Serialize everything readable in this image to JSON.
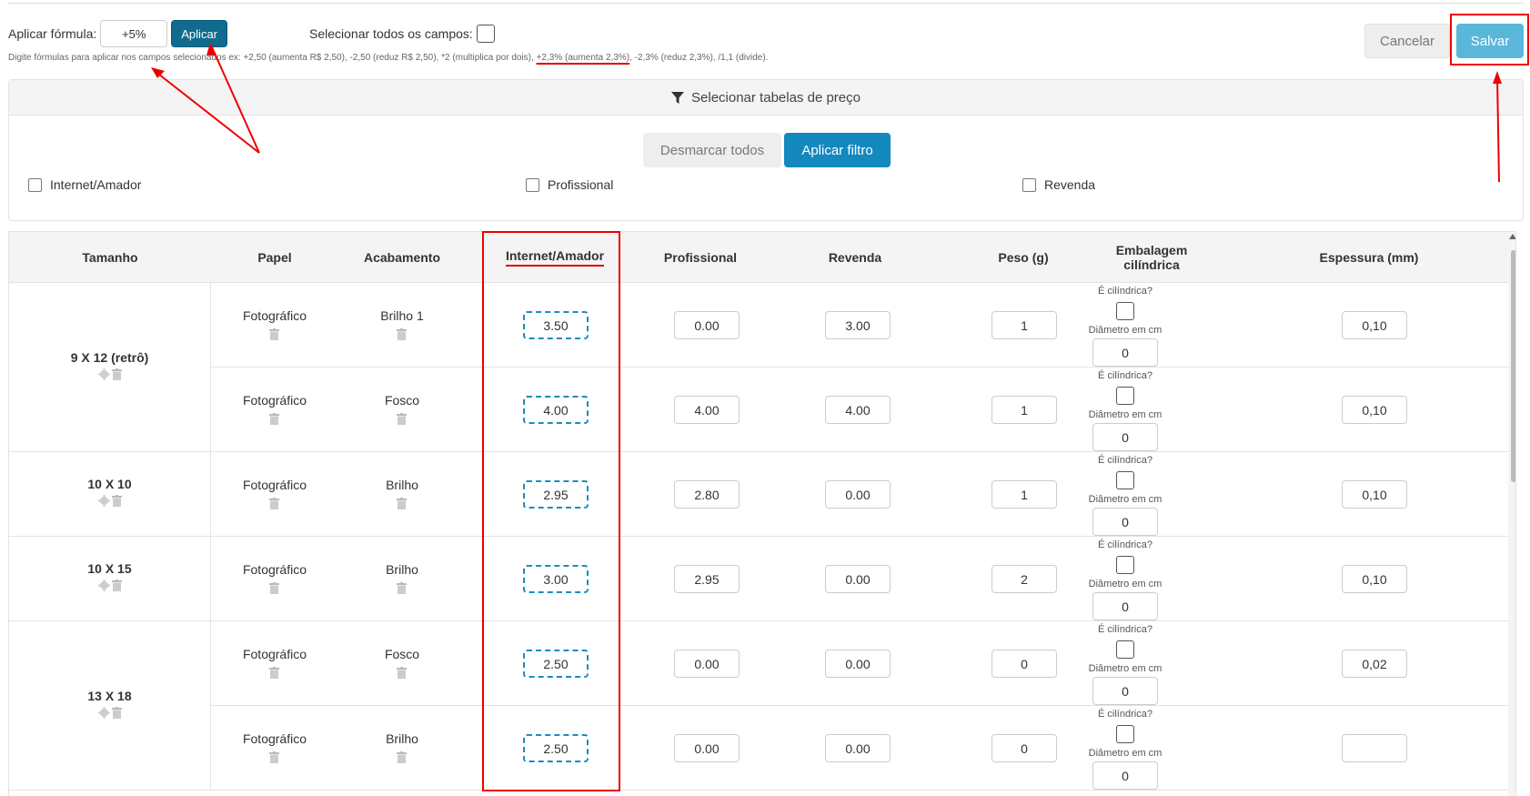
{
  "formula": {
    "label": "Aplicar fórmula:",
    "value": "+5%",
    "apply_label": "Aplicar",
    "select_all_label": "Selecionar todos os campos:",
    "hint_before": "Digite fórmulas para aplicar nos campos selecionados ex: +2,50 (aumenta R$ 2,50), -2,50 (reduz R$ 2,50), *2 (multiplica por dois), ",
    "hint_highlight": "+2,3% (aumenta 2,3%)",
    "hint_after": ", -2,3% (reduz 2,3%), /1,1 (divide)."
  },
  "actions": {
    "cancel_label": "Cancelar",
    "save_label": "Salvar"
  },
  "filter": {
    "title": "Selecionar tabelas de preço",
    "unmark_label": "Desmarcar todos",
    "apply_label": "Aplicar filtro",
    "options": [
      "Internet/Amador",
      "Profissional",
      "Revenda"
    ]
  },
  "table": {
    "headers": {
      "size": "Tamanho",
      "paper": "Papel",
      "finish": "Acabamento",
      "internet": "Internet/Amador",
      "professional": "Profissional",
      "resale": "Revenda",
      "weight": "Peso (g)",
      "packaging": "Embalagem cilíndrica",
      "thickness": "Espessura (mm)"
    },
    "cylindrical_question": "É cilíndrica?",
    "diameter_label": "Diâmetro em cm",
    "sizes": [
      "9 X 12 (retrô)",
      "10 X 10",
      "10 X 15",
      "13 X 18"
    ],
    "rows": [
      {
        "paper": "Fotográfico",
        "finish": "Brilho 1",
        "internet": "3.50",
        "professional": "0.00",
        "resale": "3.00",
        "weight": "1",
        "diameter": "0",
        "thickness": "0,10"
      },
      {
        "paper": "Fotográfico",
        "finish": "Fosco",
        "internet": "4.00",
        "professional": "4.00",
        "resale": "4.00",
        "weight": "1",
        "diameter": "0",
        "thickness": "0,10"
      },
      {
        "paper": "Fotográfico",
        "finish": "Brilho",
        "internet": "2.95",
        "professional": "2.80",
        "resale": "0.00",
        "weight": "1",
        "diameter": "0",
        "thickness": "0,10"
      },
      {
        "paper": "Fotográfico",
        "finish": "Brilho",
        "internet": "3.00",
        "professional": "2.95",
        "resale": "0.00",
        "weight": "2",
        "diameter": "0",
        "thickness": "0,10"
      },
      {
        "paper": "Fotográfico",
        "finish": "Fosco",
        "internet": "2.50",
        "professional": "0.00",
        "resale": "0.00",
        "weight": "0",
        "diameter": "0",
        "thickness": "0,02"
      },
      {
        "paper": "Fotográfico",
        "finish": "Brilho",
        "internet": "2.50",
        "professional": "0.00",
        "resale": "0.00",
        "weight": "0",
        "diameter": "0",
        "thickness": ""
      }
    ]
  },
  "colors": {
    "primary": "#116b8f",
    "accent": "#1389bd",
    "save": "#5ab7da",
    "annotation": "#e00000"
  },
  "icons": [
    "filter-icon",
    "gear-icon",
    "trash-icon"
  ]
}
